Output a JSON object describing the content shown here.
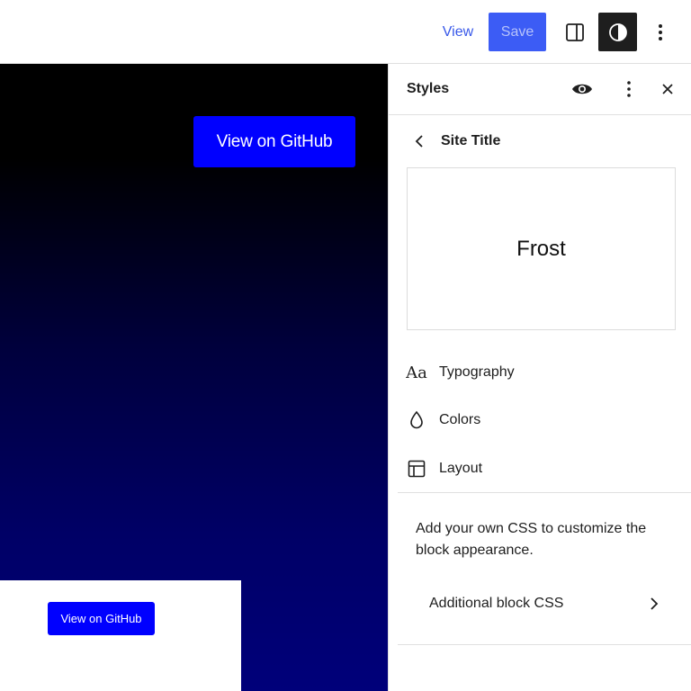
{
  "topbar": {
    "view_label": "View",
    "save_label": "Save"
  },
  "canvas": {
    "github_button_large": "View on GitHub",
    "github_button_small": "View on GitHub"
  },
  "sidebar": {
    "title": "Styles",
    "subtitle": "Site Title",
    "preview_text": "Frost",
    "nav": [
      {
        "label": "Typography",
        "icon": "typography-icon",
        "glyph": "Aa"
      },
      {
        "label": "Colors",
        "icon": "droplet-icon"
      },
      {
        "label": "Layout",
        "icon": "layout-icon"
      }
    ],
    "css_description": "Add your own CSS to customize the block appearance.",
    "css_link_label": "Additional block CSS"
  },
  "colors": {
    "accent": "#3858e9",
    "save_bg": "#3c5cf5",
    "github_blue": "#0000ff",
    "dark": "#1e1e1e"
  }
}
